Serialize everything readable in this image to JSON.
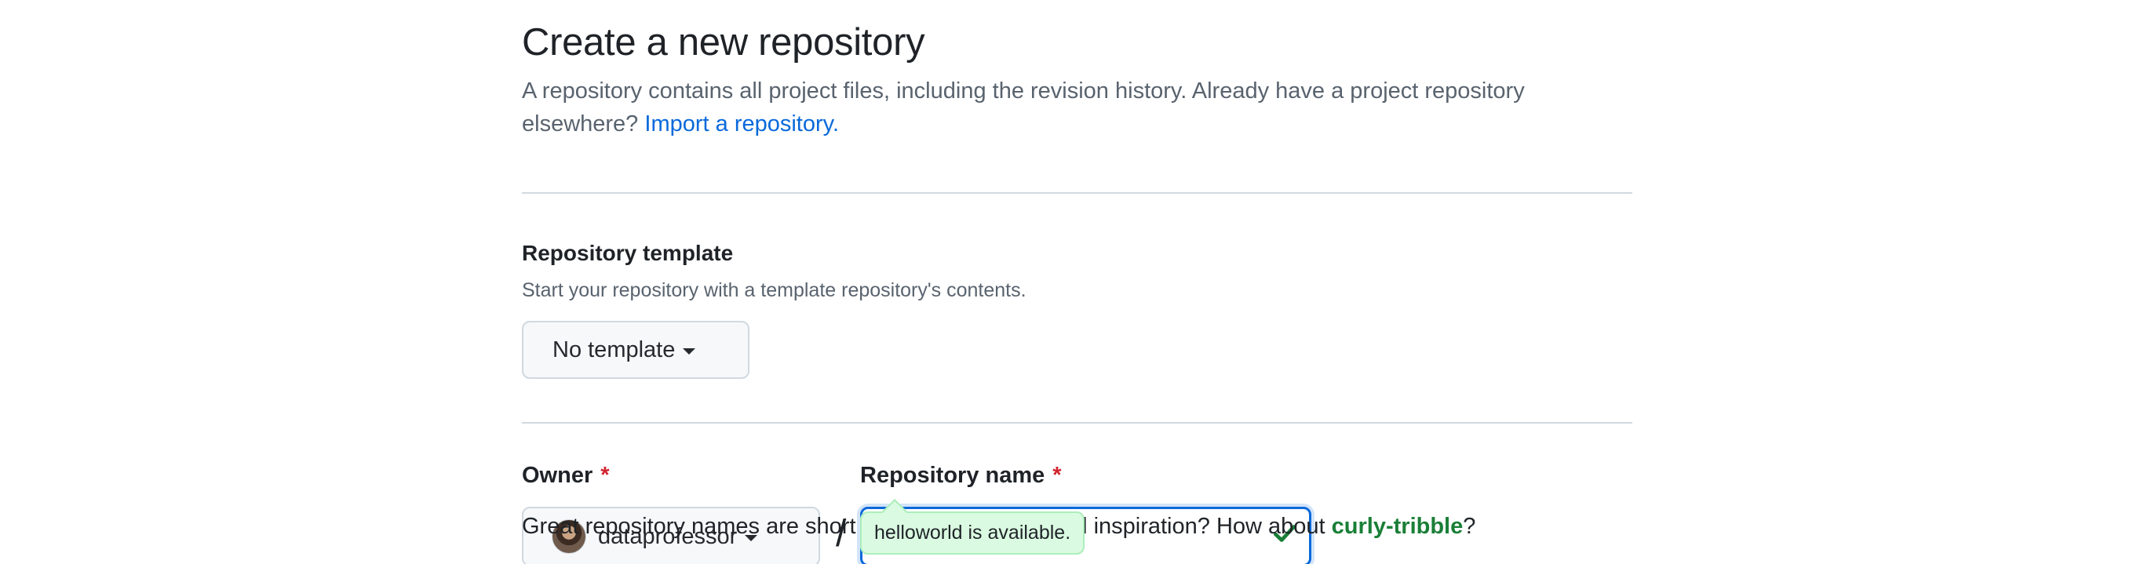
{
  "header": {
    "title": "Create a new repository",
    "description": "A repository contains all project files, including the revision history. Already have a project repository elsewhere?",
    "import_link": "Import a repository."
  },
  "template_section": {
    "heading": "Repository template",
    "note": "Start your repository with a template repository's contents.",
    "dropdown_label": "No template"
  },
  "owner": {
    "label": "Owner",
    "required_mark": "*",
    "value": "dataprofessor",
    "avatar_icon": "user-avatar"
  },
  "separator": "/",
  "repository_name": {
    "label": "Repository name",
    "required_mark": "*",
    "value": "helloworld",
    "status_icon": "check-icon",
    "status_color": "#1a7f37"
  },
  "availability_tooltip": "helloworld is available.",
  "hint": {
    "prefix": "Great repository names are short and memorable. Need inspiration? How about",
    "suggestion": "curly-tribble",
    "suffix": "?"
  },
  "colors": {
    "link": "#0969da",
    "focus_border": "#0969da",
    "required": "#d1242f",
    "success": "#1a7f37",
    "tooltip_bg": "#dafbe1"
  }
}
